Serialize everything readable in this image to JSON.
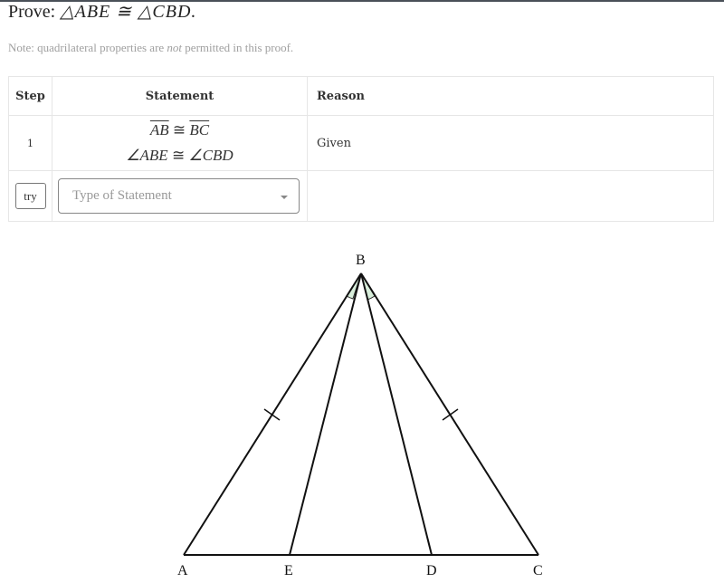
{
  "problem": {
    "prove_label": "Prove:",
    "prove_statement": "△ABE ≅ △CBD.",
    "note_prefix": "Note: quadrilateral properties are ",
    "note_emphasis": "not",
    "note_suffix": " permitted in this proof."
  },
  "table": {
    "headers": {
      "step": "Step",
      "statement": "Statement",
      "reason": "Reason"
    },
    "rows": [
      {
        "step": "1",
        "statements": [
          {
            "left": "AB",
            "rel": "≅",
            "right": "BC",
            "type": "segment"
          },
          {
            "left": "∠ABE",
            "rel": "≅",
            "right": "∠CBD",
            "type": "angle"
          }
        ],
        "reason": "Given"
      }
    ],
    "input_row": {
      "try_label": "try",
      "statement_placeholder": "Type of Statement"
    }
  },
  "diagram": {
    "points": {
      "A": "A",
      "B": "B",
      "C": "C",
      "D": "D",
      "E": "E"
    },
    "segments": [
      "AB",
      "BC",
      "AC",
      "BE",
      "BD"
    ],
    "tick_marks": [
      "AB",
      "BC"
    ],
    "marked_angles": [
      "ABE",
      "CBD"
    ],
    "angle_fill_color": "#d8eedb"
  }
}
